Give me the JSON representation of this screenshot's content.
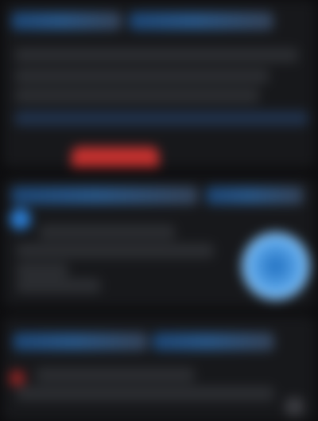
{
  "feed": {
    "card1": {
      "title": "",
      "button_label": ""
    },
    "card2": {
      "title": "",
      "badge_label": ""
    },
    "card3": {
      "title": ""
    }
  },
  "colors": {
    "background": "#0d0d0f",
    "card": "#17181b",
    "accent_blue": "#2a7bd0",
    "accent_red": "#c3312f"
  },
  "icons": {
    "avatar": "avatar-icon",
    "status": "status-icon"
  }
}
